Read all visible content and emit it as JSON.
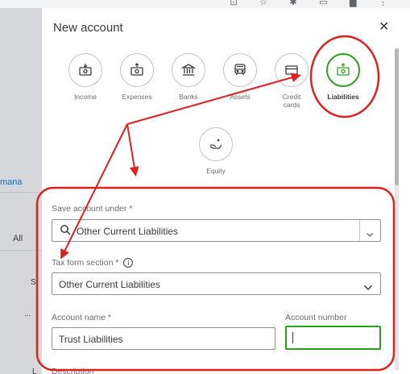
{
  "panel": {
    "title": "New account",
    "close_icon": "close-icon"
  },
  "background": {
    "fragment_mana": "mana",
    "fragment_all": "All",
    "fragment_s": "S",
    "fragment_dots": "...",
    "fragment_l": "L"
  },
  "account_types": [
    {
      "label": "Income",
      "icon": "money-down-icon"
    },
    {
      "label": "Expenses",
      "icon": "money-up-icon"
    },
    {
      "label": "Banks",
      "icon": "bank-icon"
    },
    {
      "label": "Assets",
      "icon": "truck-icon"
    },
    {
      "label": "Credit cards",
      "icon": "credit-card-icon"
    },
    {
      "label": "Liabilities",
      "icon": "money-up-icon",
      "selected": true
    },
    {
      "label": "Equity",
      "icon": "hand-money-icon"
    }
  ],
  "form": {
    "save_under": {
      "label": "Save account under *",
      "value": "Other Current Liabilities"
    },
    "tax_form": {
      "label": "Tax form section *",
      "value": "Other Current Liabilities"
    },
    "account_name": {
      "label": "Account name *",
      "value": "Trust Liabilities"
    },
    "account_number": {
      "label": "Account number",
      "value": ""
    },
    "description": {
      "label": "Description"
    }
  },
  "colors": {
    "selected_green": "#2ca01c",
    "annotation_red": "#e0201f",
    "text_dark": "#393a3d"
  }
}
